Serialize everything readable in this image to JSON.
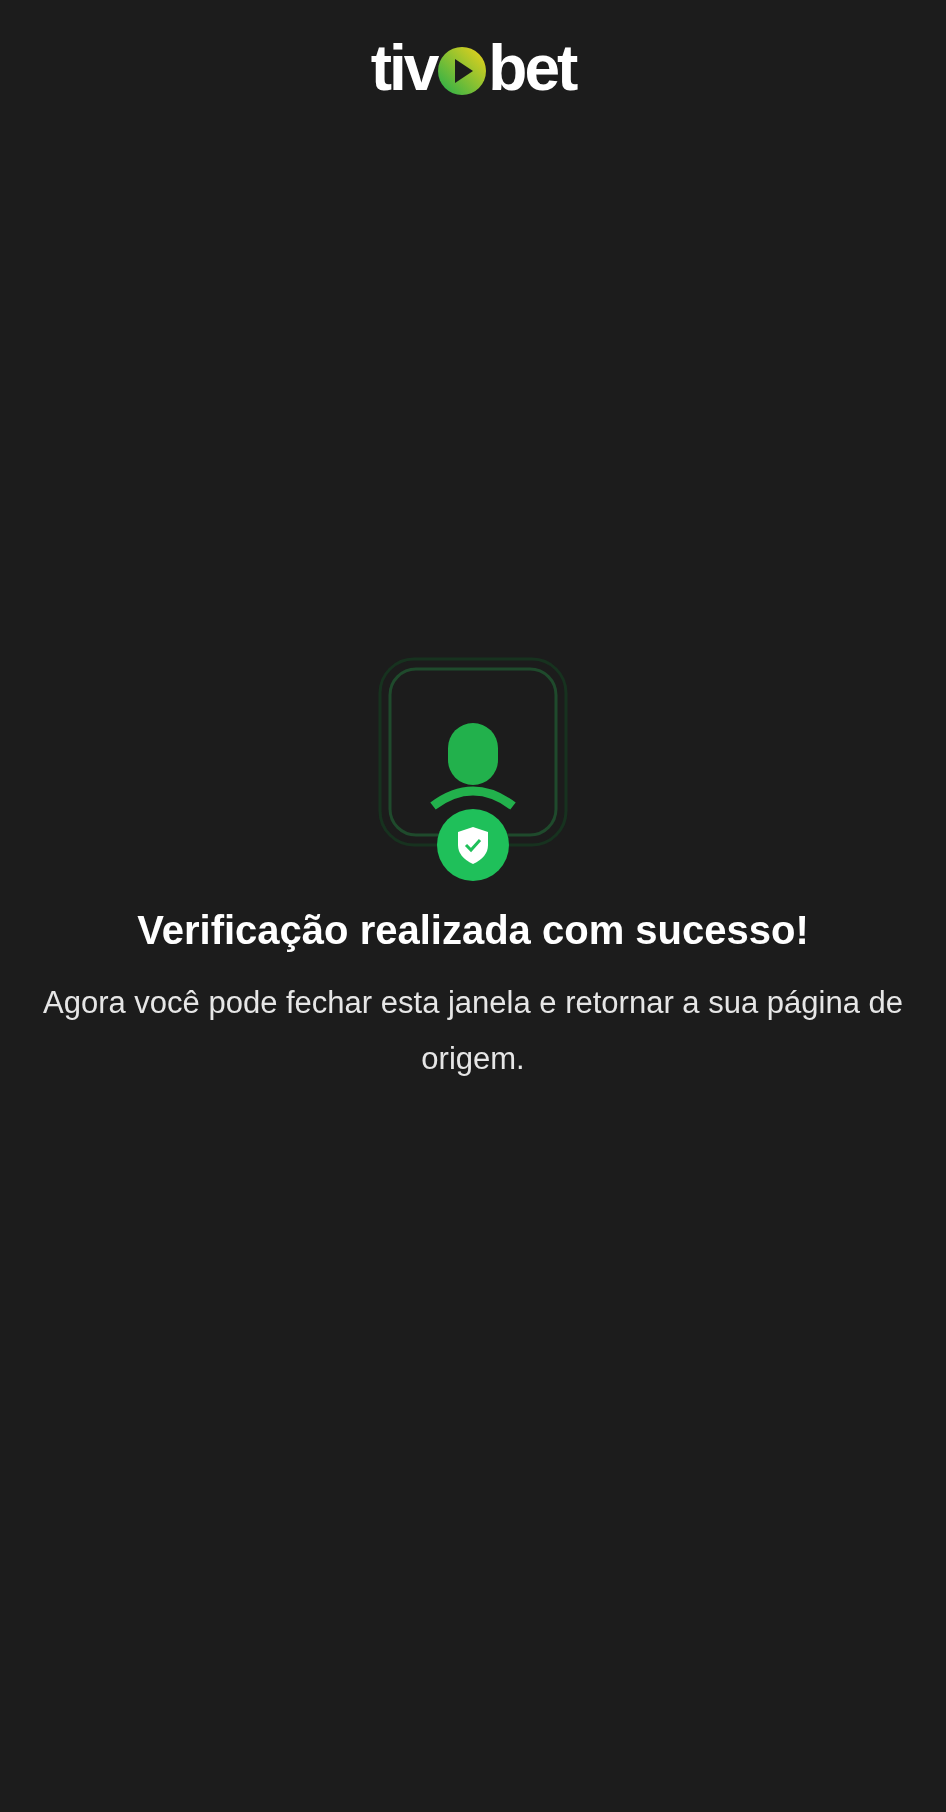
{
  "logo": {
    "before": "tiv",
    "after": "bet"
  },
  "title": "Verificação realizada com sucesso!",
  "message": "Agora você pode fechar esta janela e retornar a sua página de origem."
}
